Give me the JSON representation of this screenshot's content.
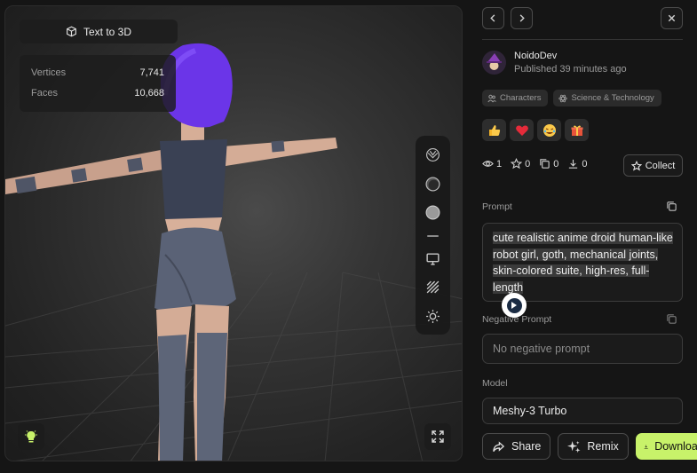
{
  "viewer": {
    "mode_label": "Text to 3D",
    "stats": [
      {
        "label": "Vertices",
        "value": "7,741"
      },
      {
        "label": "Faces",
        "value": "10,668"
      }
    ],
    "tools": [
      "wireframe-sphere-icon",
      "shaded-sphere-icon",
      "solid-sphere-icon",
      "screen-icon",
      "hatch-pattern-icon",
      "sun-icon"
    ],
    "bottom_left_icon": "lightbulb-icon",
    "bottom_right_icon": "fullscreen-icon",
    "accent_hair": "#6b35e8"
  },
  "panel": {
    "author": {
      "name": "NoidoDev",
      "published": "Published 39 minutes ago"
    },
    "tags": [
      "Characters",
      "Science & Technology"
    ],
    "reactions": [
      "thumbs-up",
      "heart",
      "laughing-face",
      "gift"
    ],
    "metrics": {
      "views": "1",
      "stars": "0",
      "copies": "0",
      "downloads": "0"
    },
    "collect_label": "Collect",
    "prompt_label": "Prompt",
    "prompt_text": "cute realistic anime droid human-like robot girl, goth, mechanical joints, skin-colored suite, high-res, full-length",
    "negative_prompt_label": "Negative Prompt",
    "negative_prompt_placeholder": "No negative prompt",
    "model_label": "Model",
    "model_value": "Meshy-3 Turbo",
    "buttons": {
      "share": "Share",
      "remix": "Remix",
      "download": "Download"
    },
    "download_color": "#c8f26a"
  }
}
